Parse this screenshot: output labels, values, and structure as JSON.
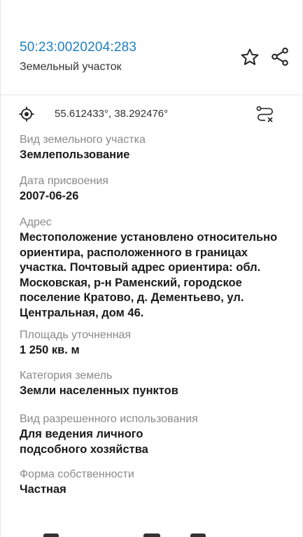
{
  "header": {
    "cadastral_number": "50:23:0020204:283",
    "object_type": "Земельный участок"
  },
  "coords": {
    "text": "55.612433°, 38.292476°"
  },
  "fields": [
    {
      "label": "Вид земельного участка",
      "value": "Землепользование"
    },
    {
      "label": "Дата присвоения",
      "value": "2007-06-26"
    },
    {
      "label": "Адрес",
      "value": "Местоположение установлено относительно ориентира, расположенного в границах участка. Почтовый адрес ориентира: обл. Московская, р-н Раменский, городское поселение Кратово, д. Дементьево, ул. Центральная, дом 46."
    },
    {
      "label": "Площадь уточненная",
      "value": "1 250 кв. м"
    },
    {
      "label": "Категория земель",
      "value": "Земли населенных пунктов"
    },
    {
      "label": "Вид разрешенного использования",
      "value": "Для ведения личного подсобного хозяйства"
    },
    {
      "label": "Форма собственности",
      "value": "Частная"
    }
  ],
  "icons": {
    "favorite": "star-icon",
    "share": "share-icon",
    "location": "target-icon",
    "route": "route-cancel-icon"
  },
  "colors": {
    "link": "#1e7fc0",
    "label": "#8a8a8a",
    "value": "#1a1a1a"
  }
}
